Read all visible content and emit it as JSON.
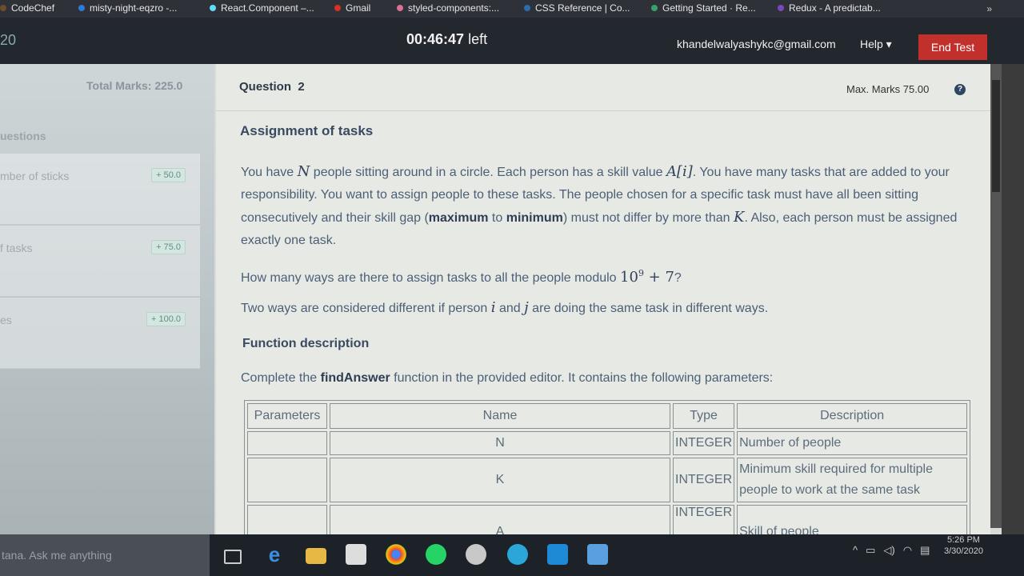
{
  "bookmarks": [
    {
      "label": "CodeChef",
      "color": "#6b4e2e"
    },
    {
      "label": "misty-night-eqzro -...",
      "color": "#2d7bd6"
    },
    {
      "label": "React.Component –...",
      "color": "#61dafb"
    },
    {
      "label": "Gmail",
      "color": "#d93025"
    },
    {
      "label": "styled-components:...",
      "color": "#db7093"
    },
    {
      "label": "CSS Reference | Co...",
      "color": "#2b6cb0"
    },
    {
      "label": "Getting Started · Re...",
      "color": "#38a169"
    },
    {
      "label": "Redux - A predictab...",
      "color": "#764abc"
    }
  ],
  "bookmarks_more": "»",
  "header": {
    "left_number": "20",
    "timer": "00:46:47",
    "timer_suffix": " left",
    "email": "khandelwalyashykc@gmail.com",
    "help_label": "Help ▾",
    "end_test_label": "End Test"
  },
  "sidebar": {
    "total_marks": "Total Marks: 225.0",
    "questions_heading": "uestions",
    "items": [
      {
        "title": "mber of sticks",
        "badge": "+ 50.0"
      },
      {
        "title": "f tasks",
        "badge": "+ 75.0"
      },
      {
        "title": "es",
        "badge": "+ 100.0"
      }
    ]
  },
  "question": {
    "label": "Question",
    "number": "2",
    "max_marks": "Max. Marks 75.00",
    "help_icon": "?",
    "title": "Assignment of tasks",
    "p1": {
      "a": "You have ",
      "N": "N",
      "b": " people sitting around in a circle. Each person has a skill value ",
      "Ai": "A[i]",
      "c": ". You have many tasks that are added to your responsibility. You want to assign people to these tasks. The people chosen for a specific task must have all been sitting consecutively and their skill gap (",
      "max": "maximum",
      "to": " to ",
      "min": "minimum",
      "d": ") must not differ by more than ",
      "K": "K",
      "e": ". Also, each person must be assigned exactly one task."
    },
    "p2": {
      "a": "How many ways are there to assign tasks to all the people modulo ",
      "mod_base": "10",
      "mod_exp": "9",
      "mod_tail": " + 7",
      "b": "?"
    },
    "p3": {
      "a": "Two ways are considered different if person ",
      "i": "i",
      "and": " and ",
      "j": "j",
      "b": " are doing the same task in different ways."
    },
    "function_heading": "Function description",
    "p4": {
      "a": "Complete the ",
      "fn": "findAnswer",
      "b": " function in the provided editor. It contains the following parameters:"
    },
    "table": {
      "headers": [
        "Parameters",
        "Name",
        "Type",
        "Description"
      ],
      "rows": [
        {
          "param": "",
          "name": "N",
          "type": "INTEGER",
          "desc": "Number of people"
        },
        {
          "param": "",
          "name": "K",
          "type": "INTEGER",
          "desc": "Minimum skill required for multiple people to work at the same task"
        },
        {
          "param": "",
          "name": "A",
          "type": "INTEGER",
          "desc": "Skill of people"
        }
      ]
    }
  },
  "taskbar": {
    "cortana": "tana. Ask me anything",
    "time": "5:26 PM",
    "date": "3/30/2020"
  }
}
